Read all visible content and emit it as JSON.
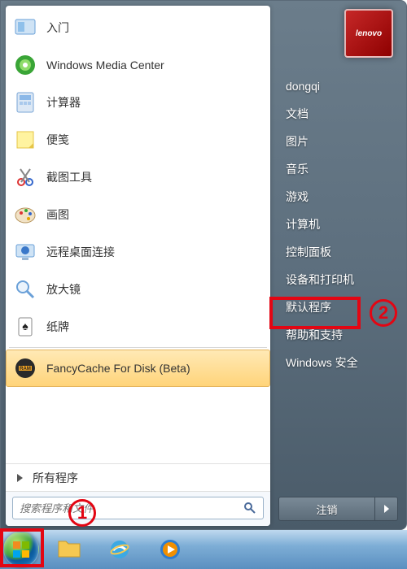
{
  "brand": "lenovo",
  "programs": [
    {
      "label": "入门",
      "icon": "getting-started-icon"
    },
    {
      "label": "Windows Media Center",
      "icon": "media-center-icon"
    },
    {
      "label": "计算器",
      "icon": "calculator-icon"
    },
    {
      "label": "便笺",
      "icon": "sticky-notes-icon"
    },
    {
      "label": "截图工具",
      "icon": "snipping-tool-icon"
    },
    {
      "label": "画图",
      "icon": "paint-icon"
    },
    {
      "label": "远程桌面连接",
      "icon": "remote-desktop-icon"
    },
    {
      "label": "放大镜",
      "icon": "magnifier-icon"
    },
    {
      "label": "纸牌",
      "icon": "solitaire-icon"
    },
    {
      "label": "FancyCache For Disk (Beta)",
      "icon": "fancycache-icon",
      "selected": true
    }
  ],
  "all_programs_label": "所有程序",
  "search": {
    "placeholder": "搜索程序和文件"
  },
  "user_name": "dongqi",
  "right_items": [
    "文档",
    "图片",
    "音乐",
    "游戏",
    "计算机",
    "控制面板",
    "设备和打印机",
    "默认程序",
    "帮助和支持",
    "Windows 安全"
  ],
  "shutdown_label": "注销",
  "annotations": {
    "highlight_start_button": true,
    "highlight_right_item_index": 5,
    "number_1": "1",
    "number_2": "2"
  },
  "colors": {
    "highlight": "#e30613",
    "selected_bg": "#ffd47a"
  }
}
